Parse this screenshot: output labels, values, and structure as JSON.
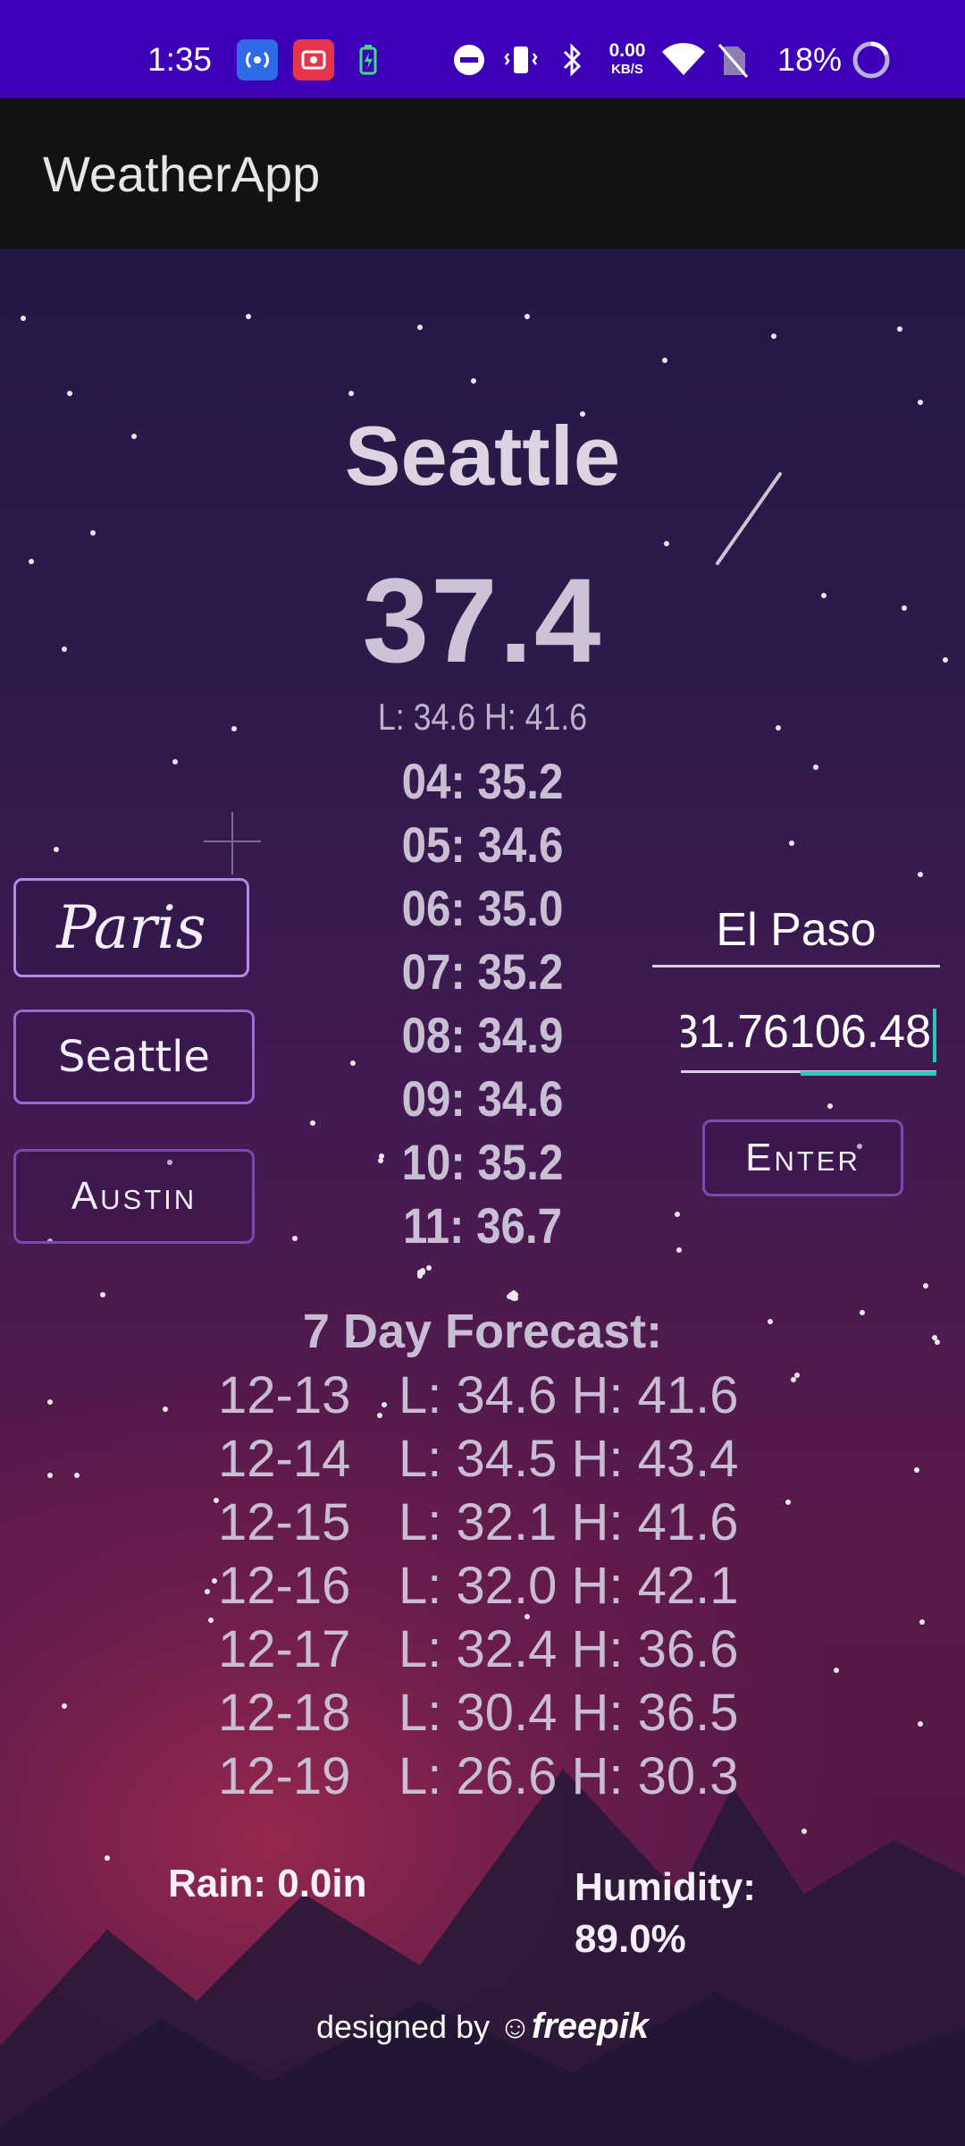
{
  "status_bar": {
    "time": "1:35",
    "net_speed": "0.00",
    "net_speed_unit": "KB/S",
    "battery_percent": "18%"
  },
  "app_bar": {
    "title": "WeatherApp"
  },
  "weather": {
    "city": "Seattle",
    "current_temp": "37.4",
    "low_high": "L: 34.6 H: 41.6",
    "hourly": [
      "04: 35.2",
      "05: 34.6",
      "06: 35.0",
      "07: 35.2",
      "08: 34.9",
      "09: 34.6",
      "10: 35.2",
      "11: 36.7"
    ]
  },
  "city_buttons": {
    "paris": "Paris",
    "seattle": "Seattle",
    "austin": "Austin"
  },
  "search": {
    "city_value": "El Paso",
    "coords_value": "31.76106.48",
    "enter_label": "Enter"
  },
  "forecast": {
    "title": "7 Day Forecast:",
    "days": [
      {
        "date": "12-13",
        "range": "L: 34.6 H: 41.6"
      },
      {
        "date": "12-14",
        "range": "L: 34.5 H: 43.4"
      },
      {
        "date": "12-15",
        "range": "L: 32.1 H: 41.6"
      },
      {
        "date": "12-16",
        "range": "L: 32.0 H: 42.1"
      },
      {
        "date": "12-17",
        "range": "L: 32.4 H: 36.6"
      },
      {
        "date": "12-18",
        "range": "L: 30.4 H: 36.5"
      },
      {
        "date": "12-19",
        "range": "L: 26.6 H: 30.3"
      }
    ]
  },
  "details": {
    "rain": "Rain: 0.0in",
    "humidity_label": "Humidity:",
    "humidity_value": "89.0%"
  },
  "credit": {
    "prefix": "designed by",
    "brand": "freepik"
  },
  "colors": {
    "status_bar": "#3d00b8",
    "app_bar": "#121212",
    "accent": "#26c9b8",
    "button_border": "#9a6ad0"
  }
}
